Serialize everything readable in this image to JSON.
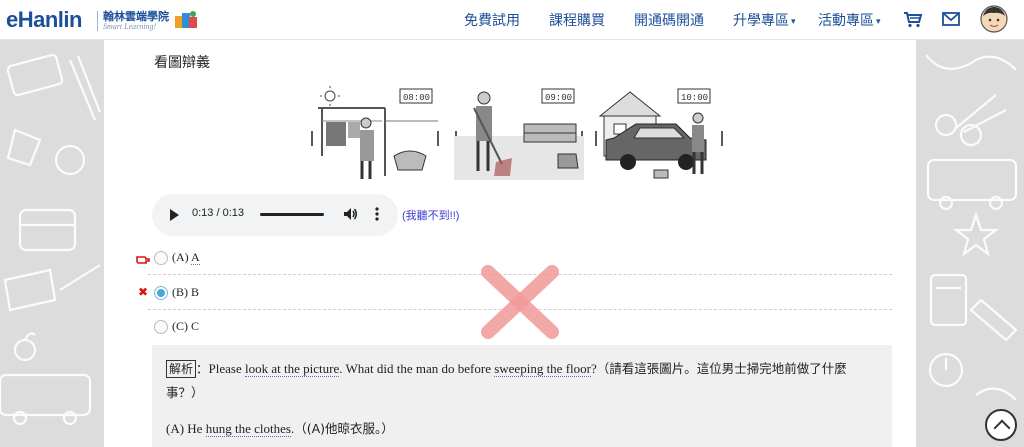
{
  "header": {
    "logo_text": "eHanlin",
    "logo_cn": "翰林雲端學院",
    "logo_en": "Smart Learning!",
    "nav": [
      {
        "label": "免費試用",
        "dropdown": false
      },
      {
        "label": "課程購買",
        "dropdown": false
      },
      {
        "label": "開通碼開通",
        "dropdown": false
      },
      {
        "label": "升學專區",
        "dropdown": true
      },
      {
        "label": "活動專區",
        "dropdown": true
      }
    ],
    "dropdown_arrow": "▾"
  },
  "question": {
    "section_title": "看圖辯義",
    "pictures": [
      {
        "clock": "08:00",
        "icon": "man-hanging-clothes"
      },
      {
        "clock": "09:00",
        "icon": "man-sweeping-floor"
      },
      {
        "clock": "10:00",
        "icon": "man-washing-car"
      }
    ],
    "audio": {
      "time": "0:13 / 0:13"
    },
    "cant_hear_link": "(我聽不到!!)",
    "options": [
      {
        "prefix": "(A)",
        "letter": "A",
        "selected": false,
        "marker": "correct-hand"
      },
      {
        "prefix": "(B)",
        "letter": "B",
        "selected": true,
        "marker": "wrong-x"
      },
      {
        "prefix": "(C)",
        "letter": "C",
        "selected": false,
        "marker": ""
      }
    ],
    "wrong_marker": "✖"
  },
  "analysis": {
    "tag": "解析",
    "colon": "：",
    "l1": "Please ",
    "l1_u1": "look at the picture",
    "l1_b": ".  What did the man do before ",
    "l1_u2": "sweeping the floor",
    "l1_c": "?",
    "l1_cn": "（請看這張圖片。這位男士掃完地前做了什麼事？）",
    "l2_prefix": "(A) He ",
    "l2_u": "hung the clothes",
    "l2_b": ".",
    "l2_cn": "（(A)他晾衣服。）"
  },
  "colors": {
    "brand": "#1e4f9a",
    "link": "#3b3bd6",
    "wrong": "#d11111",
    "selected_radio": "#49a9d6",
    "big_x": "#f29a9a"
  }
}
